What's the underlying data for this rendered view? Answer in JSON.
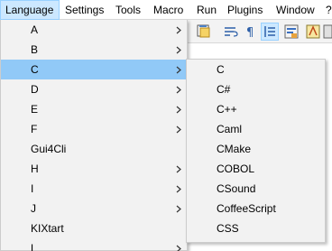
{
  "menubar": {
    "items": [
      {
        "label": "Language",
        "active": true
      },
      {
        "label": "Settings"
      },
      {
        "label": "Tools"
      },
      {
        "label": "Macro"
      },
      {
        "label": "Run"
      },
      {
        "label": "Plugins"
      },
      {
        "label": "Window"
      },
      {
        "label": "?"
      }
    ]
  },
  "language_menu": {
    "items": [
      {
        "label": "A",
        "has_submenu": true
      },
      {
        "label": "B",
        "has_submenu": true
      },
      {
        "label": "C",
        "has_submenu": true,
        "highlighted": true
      },
      {
        "label": "D",
        "has_submenu": true
      },
      {
        "label": "E",
        "has_submenu": true
      },
      {
        "label": "F",
        "has_submenu": true
      },
      {
        "label": "Gui4Cli",
        "has_submenu": false
      },
      {
        "label": "H",
        "has_submenu": true
      },
      {
        "label": "I",
        "has_submenu": true
      },
      {
        "label": "J",
        "has_submenu": true
      },
      {
        "label": "KIXtart",
        "has_submenu": false
      },
      {
        "label": "L",
        "has_submenu": true
      }
    ]
  },
  "c_submenu": {
    "items": [
      {
        "label": "C"
      },
      {
        "label": "C#"
      },
      {
        "label": "C++"
      },
      {
        "label": "Caml"
      },
      {
        "label": "CMake"
      },
      {
        "label": "COBOL"
      },
      {
        "label": "CSound"
      },
      {
        "label": "CoffeeScript"
      },
      {
        "label": "CSS"
      }
    ]
  },
  "colors": {
    "menu_highlight": "#91c9f7",
    "menubar_active": "#cce8ff"
  }
}
